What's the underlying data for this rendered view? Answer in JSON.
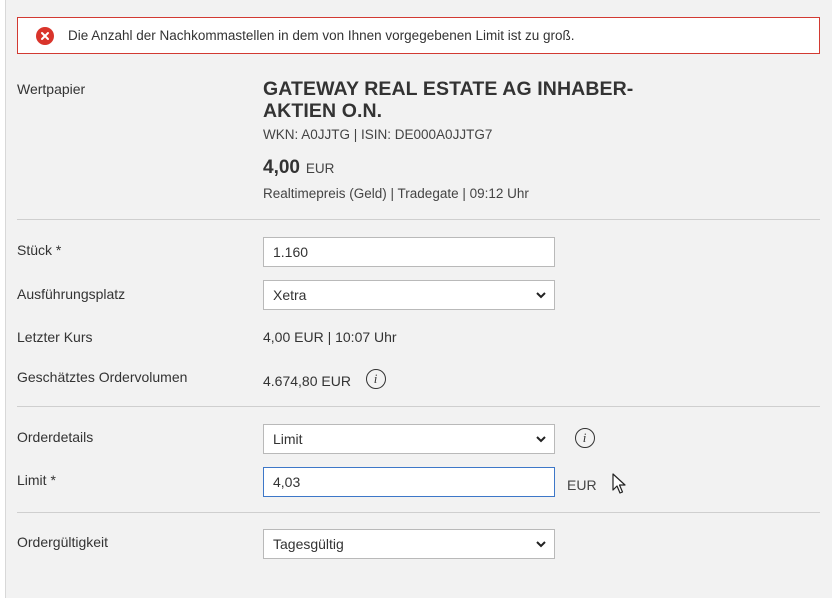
{
  "error": {
    "message": "Die Anzahl der Nachkommastellen in dem von Ihnen vorgegebenen Limit ist zu groß."
  },
  "security": {
    "label": "Wertpapier",
    "name": "GATEWAY REAL ESTATE AG INHABER-AKTIEN O.N.",
    "ids": "WKN: A0JJTG | ISIN: DE000A0JJTG7",
    "price": "4,00",
    "currency": "EUR",
    "price_info": "Realtimepreis (Geld) | Tradegate | 09:12 Uhr"
  },
  "form": {
    "quantity_label": "Stück *",
    "quantity_value": "1.160",
    "venue_label": "Ausführungsplatz",
    "venue_value": "Xetra",
    "last_price_label": "Letzter Kurs",
    "last_price_value": "4,00 EUR | 10:07 Uhr",
    "volume_label": "Geschätztes Ordervolumen",
    "volume_value": "4.674,80 EUR",
    "order_details_label": "Orderdetails",
    "order_details_value": "Limit",
    "limit_label": "Limit *",
    "limit_value": "4,03",
    "limit_unit": "EUR",
    "validity_label": "Ordergültigkeit",
    "validity_value": "Tagesgültig"
  },
  "icons": {
    "error": "error-circle-x-icon",
    "info": "info-circle-icon",
    "select": "chevron-down-icon",
    "cursor": "mouse-pointer-icon"
  },
  "colors": {
    "error_border": "#d23a32",
    "error_icon": "#d9342b",
    "focus_border": "#3d77c8",
    "panel_bg": "#f2f2f2"
  }
}
